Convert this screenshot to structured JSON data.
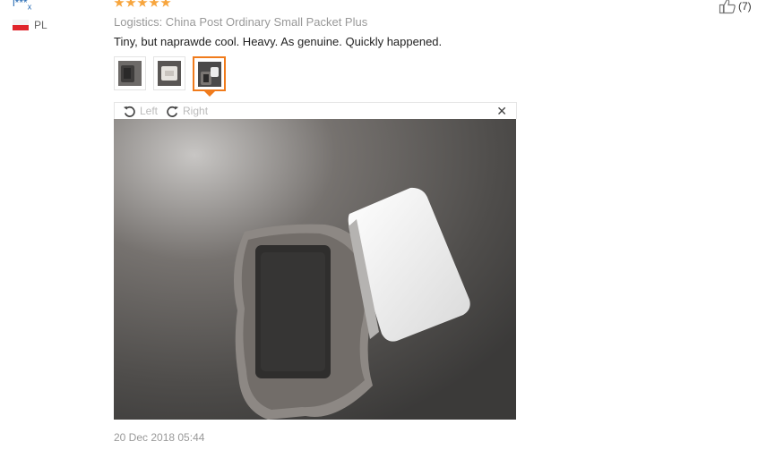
{
  "reviewer": {
    "name": "l***",
    "name_suffix": "x",
    "country_code": "PL"
  },
  "rating": {
    "stars": 5,
    "out_of": 5
  },
  "logistics": "Logistics: China Post Ordinary Small Packet Plus",
  "review_text": "Tiny, but naprawde cool. Heavy. As genuine. Quickly happened.",
  "thumbnails": [
    {
      "icon": "photo-thumbnail",
      "selected": false
    },
    {
      "icon": "photo-thumbnail",
      "selected": false
    },
    {
      "icon": "photo-thumbnail",
      "selected": true
    }
  ],
  "viewer": {
    "rotate_left_label": "Left",
    "rotate_right_label": "Right",
    "close_icon": "close-icon"
  },
  "timestamp": "20 Dec 2018 05:44",
  "helpful": {
    "icon": "thumbs-up-icon",
    "count_label": "(7)"
  },
  "colors": {
    "accent": "#f07b1c",
    "star": "#f7a53d",
    "link": "#2469b3"
  }
}
